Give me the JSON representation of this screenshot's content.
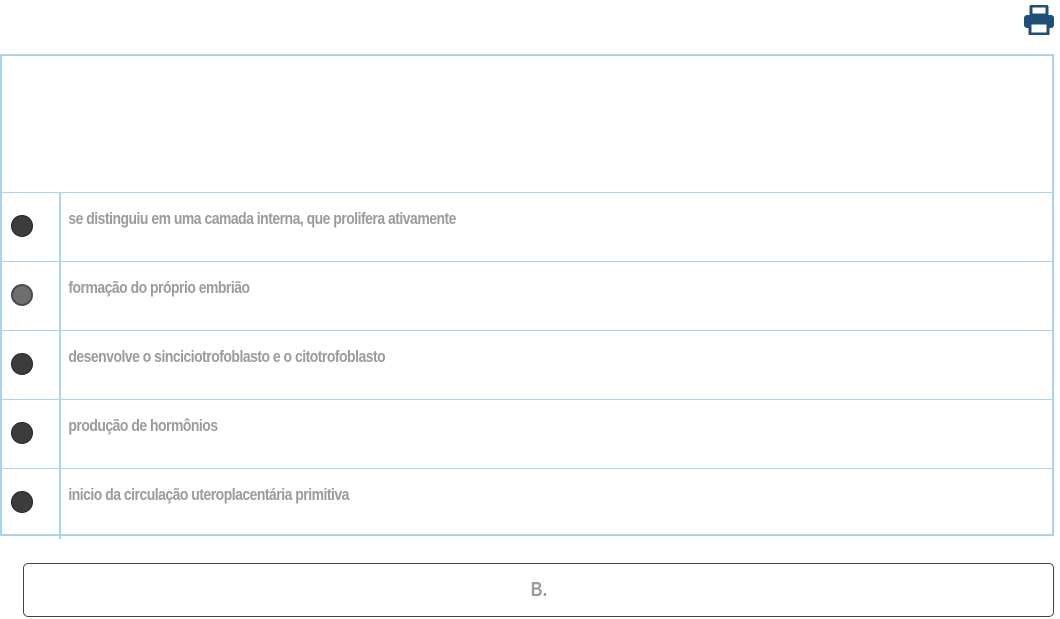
{
  "toolbar": {
    "print_icon": "printer-icon"
  },
  "question": {
    "options": [
      {
        "text": "se distinguiu em uma camada interna, que prolifera ativamente",
        "dimmed": false
      },
      {
        "text": "formação do próprio embrião",
        "dimmed": true
      },
      {
        "text": "desenvolve o sinciciotrofoblasto e o citotrofoblasto",
        "dimmed": false
      },
      {
        "text": "produção de hormônios",
        "dimmed": false
      },
      {
        "text": "inicio da circulação uteroplacentária primitiva",
        "dimmed": false
      }
    ]
  },
  "answer": {
    "label": "B."
  },
  "colors": {
    "border": "#a9d3f5",
    "option_text": "#9b9b9b",
    "print_icon": "#1f4e79"
  }
}
